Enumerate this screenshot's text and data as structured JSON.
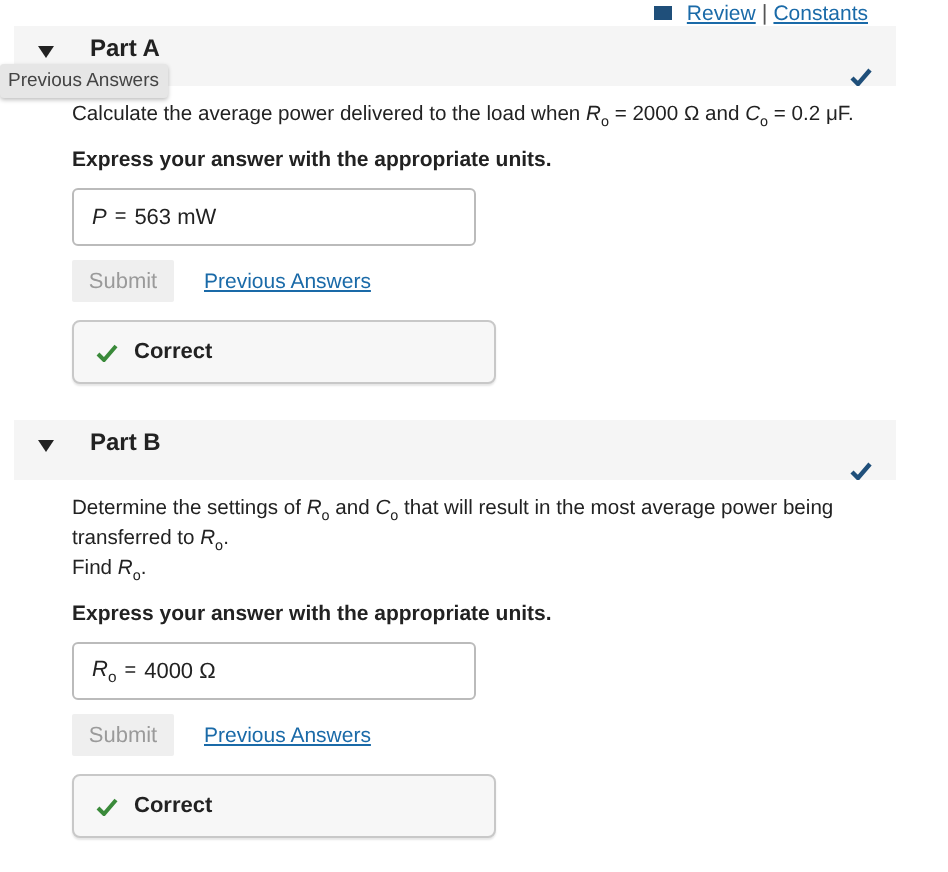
{
  "header_links": {
    "review": "Review",
    "separator": "|",
    "constants": "Constants"
  },
  "tooltip": "Previous Answers",
  "parts": [
    {
      "title": "Part A",
      "expanded": true,
      "completed": true,
      "question": [
        "Calculate the average power delivered to the load when *R*$_{o}$ = 2000 Ω and *C*$_{o}$ = 0.2 μF."
      ],
      "instruction": "Express your answer with the appropriate units.",
      "answer": {
        "label": "*P*",
        "equals": "=",
        "value": "563 mW"
      },
      "submit": {
        "label": "Submit",
        "disabled": true
      },
      "previous_link": "Previous Answers",
      "feedback": {
        "kind": "correct",
        "text": "Correct"
      }
    },
    {
      "title": "Part B",
      "expanded": true,
      "completed": true,
      "question": [
        "Determine the settings of *R*$_{o}$ and *C*$_{o}$ that will result in the most average power being transferred to *R*$_{o}$.",
        "Find *R*$_{o}$."
      ],
      "instruction": "Express your answer with the appropriate units.",
      "answer": {
        "label": "*R*$_{o}$",
        "equals": "=",
        "value": "4000 Ω"
      },
      "submit": {
        "label": "Submit",
        "disabled": true
      },
      "previous_link": "Previous Answers",
      "feedback": {
        "kind": "correct",
        "text": "Correct"
      }
    }
  ]
}
